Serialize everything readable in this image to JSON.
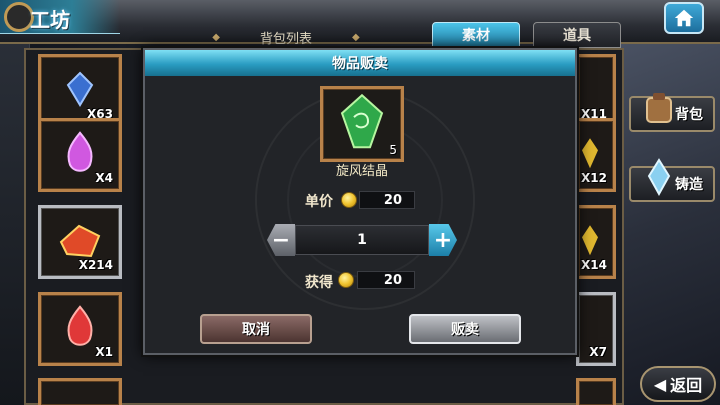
{
  "header": {
    "title": "工坊",
    "home_icon": "home-icon"
  },
  "tabs": {
    "backpack_list": "背包列表",
    "material": "素材",
    "item": "道具"
  },
  "inventory": {
    "left_column": [
      {
        "qty": "X63",
        "color": "#3a6fd0"
      },
      {
        "qty": "X4",
        "color": "#d058e0"
      },
      {
        "qty": "X214",
        "color": "#e04a28"
      },
      {
        "qty": "X1",
        "color": "#e03838"
      }
    ],
    "right_column": [
      {
        "qty": "X11",
        "color": "#6a7ac8"
      },
      {
        "qty": "X12",
        "color": "#e0b830"
      },
      {
        "qty": "X14",
        "color": "#e0b830"
      },
      {
        "qty": "X7",
        "color": "#7a8ab0"
      }
    ]
  },
  "side": {
    "backpack_label": "背包",
    "forge_label": "铸造",
    "back_label": "返回"
  },
  "dialog": {
    "title": "物品贩卖",
    "item_name": "旋风结晶",
    "item_qty": "5",
    "unit_price_label": "单价",
    "unit_price_value": "20",
    "quantity": "1",
    "gain_label": "获得",
    "gain_value": "20",
    "cancel_label": "取消",
    "sell_label": "贩卖",
    "minus_symbol": "−",
    "plus_symbol": "+"
  }
}
